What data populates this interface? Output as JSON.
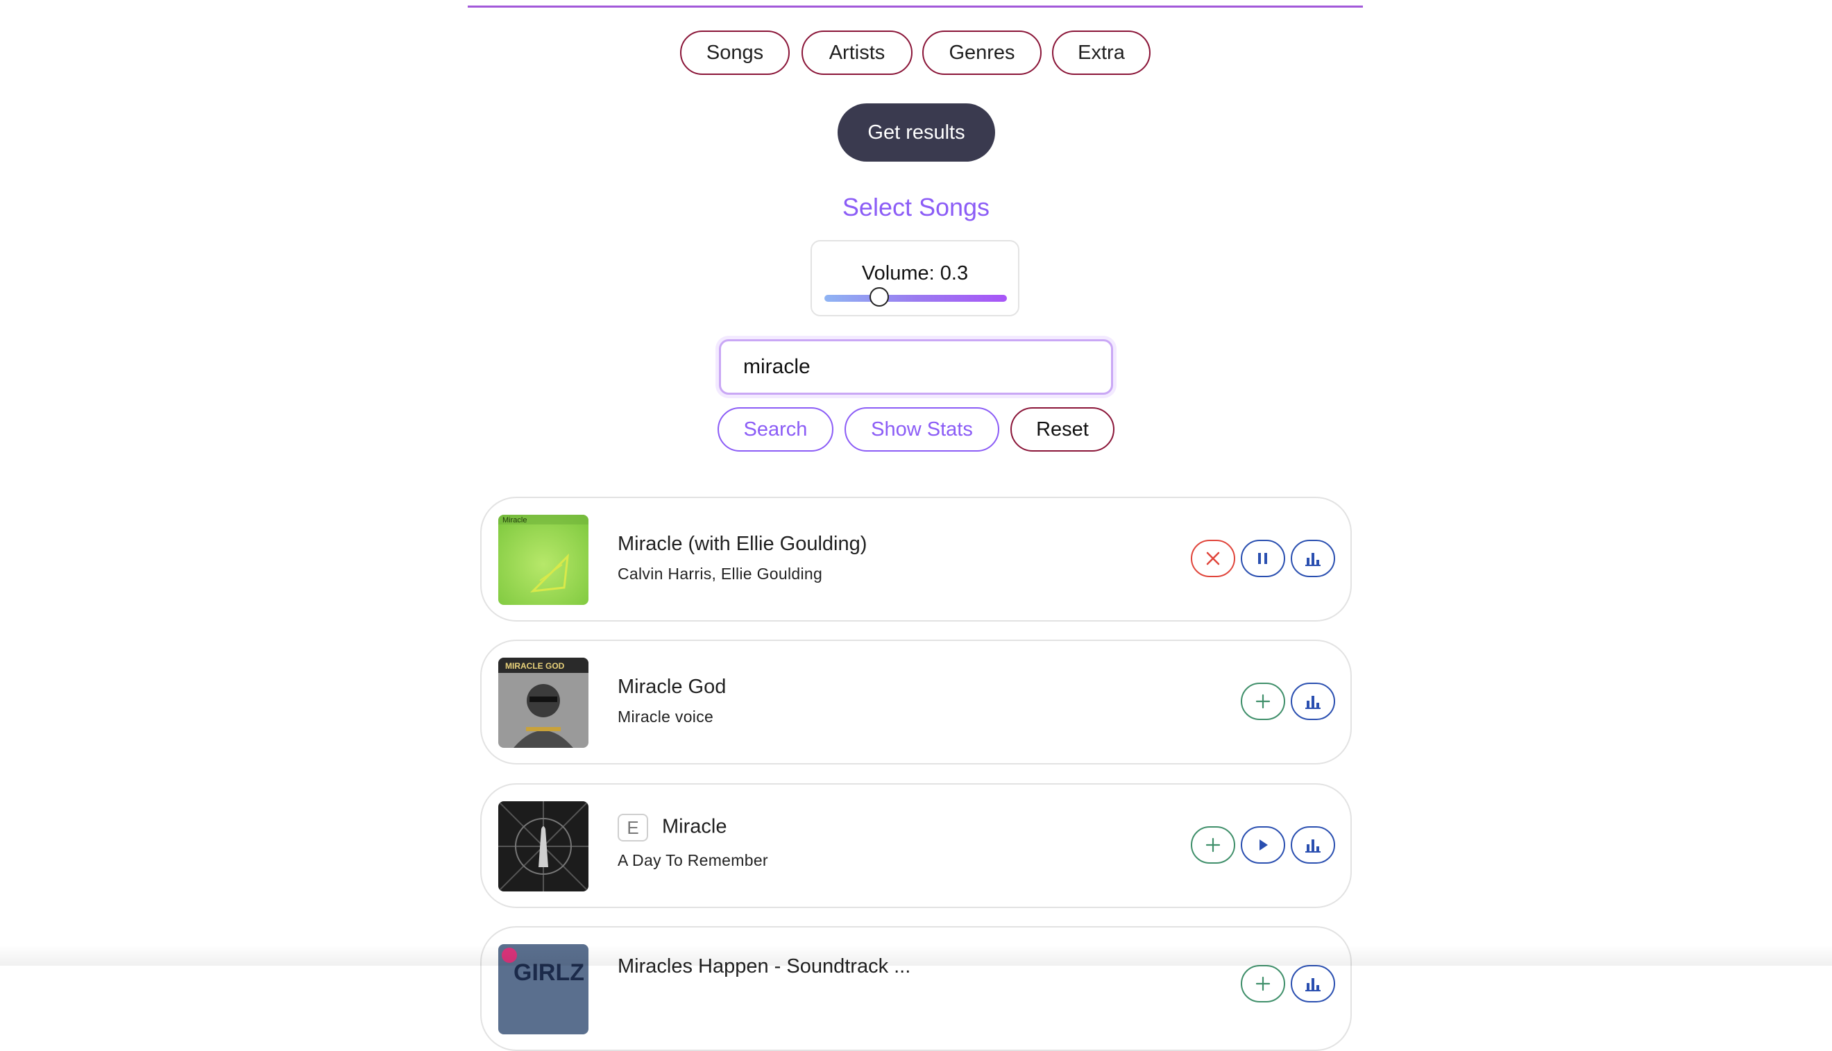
{
  "nav": {
    "tabs": [
      "Songs",
      "Artists",
      "Genres",
      "Extra"
    ]
  },
  "get_results_label": "Get results",
  "section_title": "Select Songs",
  "volume": {
    "label": "Volume: 0.3",
    "value": 0.3
  },
  "search": {
    "value": "miracle",
    "search_label": "Search",
    "stats_label": "Show Stats",
    "reset_label": "Reset"
  },
  "songs": [
    {
      "title": "Miracle (with Ellie Goulding)",
      "artist": "Calvin Harris, Ellie Goulding",
      "explicit": false,
      "selected": true,
      "state": "playing",
      "cover_text": "Miracle",
      "actions": [
        "close-icon",
        "pause-icon",
        "bar-chart-icon"
      ]
    },
    {
      "title": "Miracle God",
      "artist": "Miracle voice",
      "explicit": false,
      "selected": false,
      "state": "none",
      "cover_text": "MIRACLE GOD",
      "actions": [
        "plus-icon",
        "bar-chart-icon"
      ]
    },
    {
      "title": "Miracle",
      "artist": "A Day To Remember",
      "explicit": true,
      "explicit_label": "E",
      "selected": false,
      "state": "paused",
      "actions": [
        "plus-icon",
        "play-icon",
        "bar-chart-icon"
      ]
    },
    {
      "title": "Miracles Happen - Soundtrack ...",
      "artist": "",
      "explicit": false,
      "selected": false,
      "state": "none",
      "cover_text": "GIRLZ",
      "actions": [
        "plus-icon",
        "bar-chart-icon"
      ]
    }
  ],
  "colors": {
    "accent": "#8b5cf6",
    "maroon": "#8a1538",
    "dark_button": "#3a3a4f",
    "remove": "#e0453b",
    "blue": "#2a4fb0",
    "green": "#3f8f6a"
  }
}
